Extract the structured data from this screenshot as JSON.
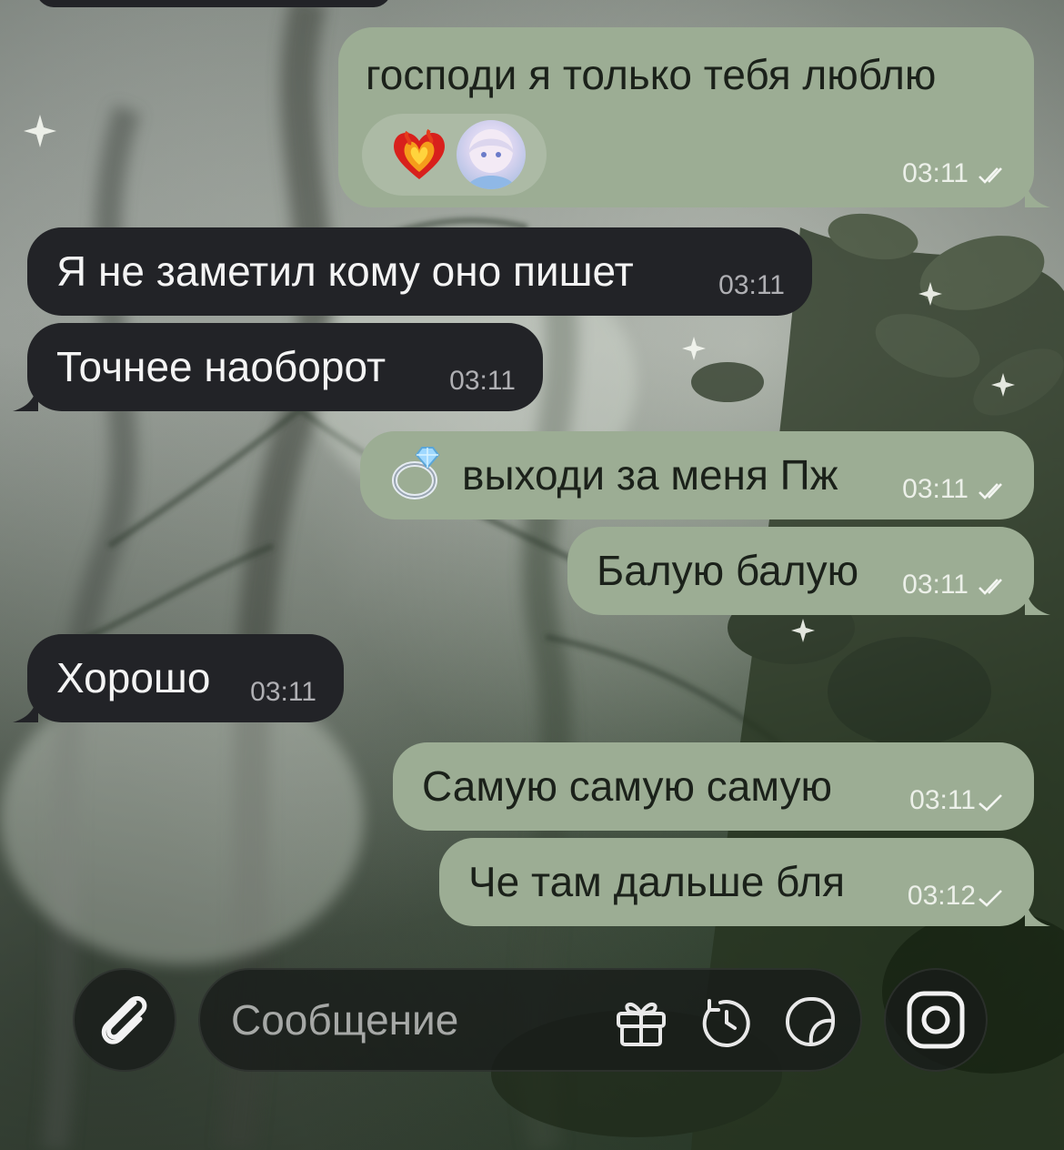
{
  "messages": [
    {
      "id": "m1",
      "side": "out",
      "text": "господи я только тебя люблю",
      "time": "03:11",
      "status": "read",
      "reactions": [
        "heart-on-fire-emoji",
        "avatar-reaction"
      ]
    },
    {
      "id": "m2",
      "side": "in",
      "text": "Я не заметил кому оно пишет",
      "time": "03:11"
    },
    {
      "id": "m3",
      "side": "in",
      "text": "Точнее наоборот",
      "time": "03:11"
    },
    {
      "id": "m4",
      "side": "out",
      "text": "выходи за меня Пж",
      "time": "03:11",
      "status": "read",
      "prefix_emoji": "ring-emoji"
    },
    {
      "id": "m5",
      "side": "out",
      "text": "Балую балую",
      "time": "03:11",
      "status": "read"
    },
    {
      "id": "m6",
      "side": "in",
      "text": "Хорошо",
      "time": "03:11"
    },
    {
      "id": "m7",
      "side": "out",
      "text": "Самую самую самую",
      "time": "03:11",
      "status": "sent"
    },
    {
      "id": "m8",
      "side": "out",
      "text": "Че там дальше бля",
      "time": "03:12",
      "status": "sent"
    }
  ],
  "composer": {
    "placeholder": "Сообщение",
    "icons": [
      "paperclip-icon",
      "gift-icon",
      "timer-icon",
      "sticker-icon",
      "camera-icon"
    ]
  },
  "colors": {
    "outgoing_bubble": "#9cad94",
    "incoming_bubble": "#222327"
  }
}
